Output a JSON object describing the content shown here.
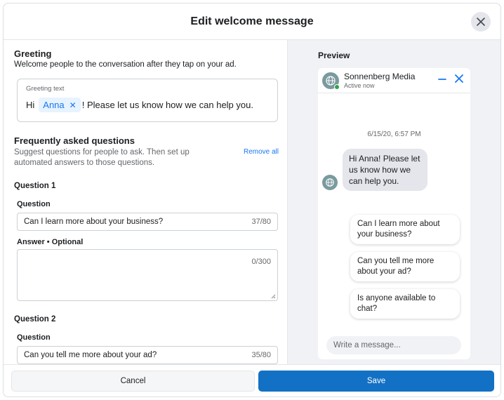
{
  "dialog": {
    "title": "Edit welcome message"
  },
  "greeting": {
    "title": "Greeting",
    "description": "Welcome people to the conversation after they tap on your ad.",
    "box_label": "Greeting text",
    "prefix": "Hi",
    "chip": "Anna",
    "suffix": "! Please let us know how we can help you."
  },
  "faq": {
    "title": "Frequently asked questions",
    "description": "Suggest questions for people to ask. Then set up automated answers to those questions.",
    "remove_all": "Remove all",
    "questions": [
      {
        "title": "Question 1",
        "question_label": "Question",
        "question_value": "Can I learn more about your business?",
        "question_counter": "37/80",
        "answer_label": "Answer • Optional",
        "answer_counter": "0/300"
      },
      {
        "title": "Question 2",
        "question_label": "Question",
        "question_value": "Can you tell me more about your ad?",
        "question_counter": "35/80"
      }
    ]
  },
  "footer": {
    "cancel": "Cancel",
    "save": "Save"
  },
  "preview": {
    "title": "Preview",
    "page_name": "Sonnenberg Media",
    "status": "Active now",
    "timestamp": "6/15/20, 6:57 PM",
    "message": "Hi Anna! Please let us know how we can help you.",
    "quick_replies": [
      "Can I learn more about your business?",
      "Can you tell me more about your ad?",
      "Is anyone available to chat?"
    ],
    "compose_placeholder": "Write a message..."
  },
  "colors": {
    "accent": "#1877f2",
    "save": "#1271c4",
    "online": "#31a24c"
  }
}
